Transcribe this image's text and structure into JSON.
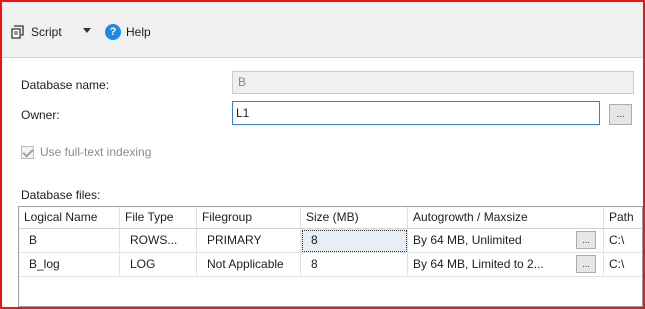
{
  "toolbar": {
    "script_label": "Script",
    "help_label": "Help",
    "help_icon_glyph": "?"
  },
  "form": {
    "database_name_label": "Database name:",
    "database_name_value": "B",
    "owner_label": "Owner:",
    "owner_value": "L1",
    "browse_label": "...",
    "fulltext_label": "Use full-text indexing",
    "files_label": "Database files:"
  },
  "grid": {
    "headers": [
      "Logical Name",
      "File Type",
      "Filegroup",
      "Size (MB)",
      "Autogrowth / Maxsize",
      "Path"
    ],
    "rows": [
      {
        "logical_name": "B",
        "file_type": "ROWS...",
        "filegroup": "PRIMARY",
        "size": "8",
        "autogrowth": "By 64 MB, Unlimited",
        "path": "C:\\"
      },
      {
        "logical_name": "B_log",
        "file_type": "LOG",
        "filegroup": "Not Applicable",
        "size": "8",
        "autogrowth": "By 64 MB, Limited to 2...",
        "path": "C:\\"
      }
    ]
  },
  "colors": {
    "frame_border": "#e0191b",
    "focus_border": "#3c7fd6",
    "help_icon": "#1e88e5"
  }
}
